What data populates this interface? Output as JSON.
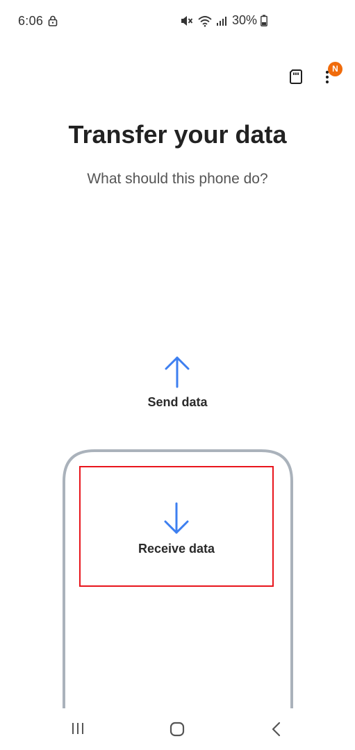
{
  "status_bar": {
    "time": "6:06",
    "battery": "30%",
    "icons": [
      "lock-icon",
      "mute-icon",
      "wifi-icon",
      "signal-icon",
      "battery-icon"
    ]
  },
  "toolbar": {
    "sd_card_icon": "sd-card-icon",
    "more_icon": "more-options-icon",
    "badge": "N",
    "badge_color": "#f06b0b"
  },
  "header": {
    "title": "Transfer your data",
    "subtitle": "What should this phone do?"
  },
  "options": {
    "send_label": "Send data",
    "receive_label": "Receive data",
    "arrow_color": "#3d7ff0",
    "highlight_color": "#e8141c"
  },
  "nav_bar": {
    "icons": [
      "recents-icon",
      "home-icon",
      "back-icon"
    ]
  }
}
